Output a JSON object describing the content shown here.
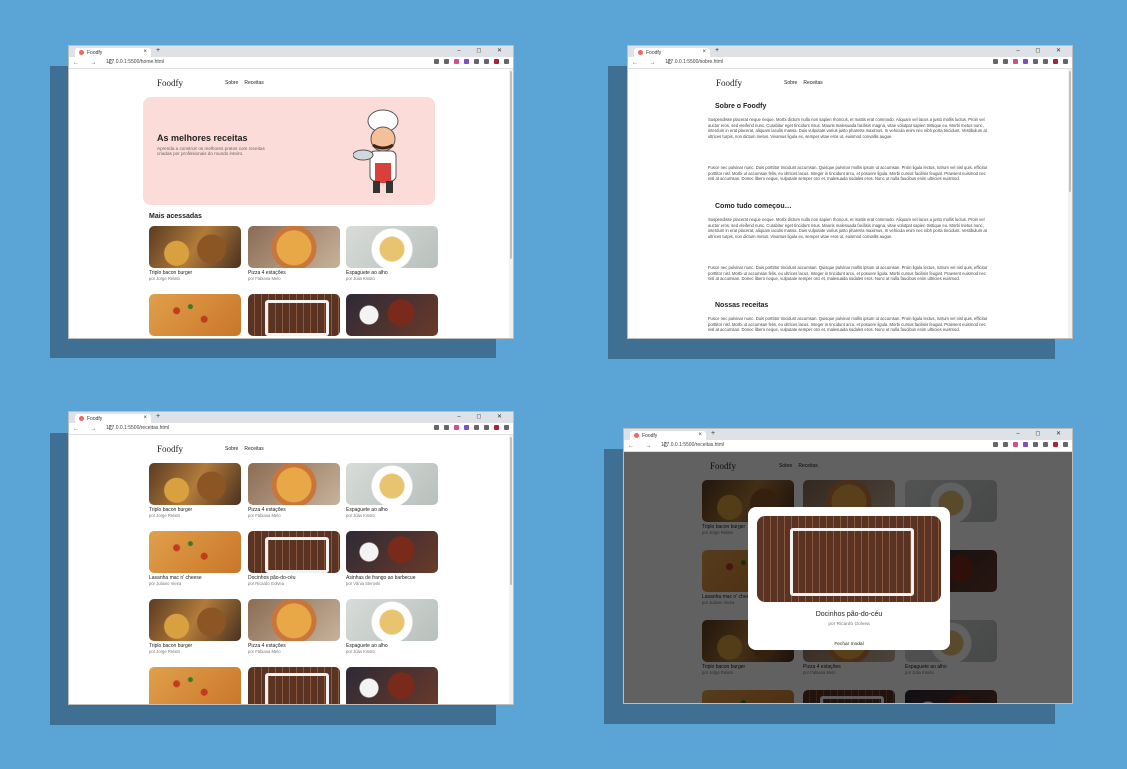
{
  "browser": {
    "tab_title": "Foodfy",
    "new_tab": "+",
    "close_tab": "×",
    "nav_icons": "← → C",
    "win_controls": "– ◻ ✕",
    "urls": {
      "home": "127.0.0.1:5500/home.html",
      "sobre": "127.0.0.1:5500/sobre.html",
      "receitas": "127.0.0.1:5500/receitas.html"
    }
  },
  "site": {
    "logo": "Foodfy",
    "menu": [
      "Sobre",
      "Receitas"
    ]
  },
  "home": {
    "hero_title": "As melhores receitas",
    "hero_text": "Aprenda a construir os melhores pratos com receitas criadas por profissionais do mundo inteiro.",
    "section_title": "Mais acessadas"
  },
  "recipes": [
    {
      "title": "Triplo bacon burger",
      "author": "por Jorge Relato",
      "image": "burger"
    },
    {
      "title": "Pizza 4 estações",
      "author": "por Fabiana Melo",
      "image": "pizza"
    },
    {
      "title": "Espaguete ao alho",
      "author": "por Júlia Kinoto",
      "image": "spag"
    },
    {
      "title": "Lasanha mac n' cheese",
      "author": "por Juliano Vieira",
      "image": "lasagna"
    },
    {
      "title": "Docinhos pão-do-céu",
      "author": "por Ricardo Golvea",
      "image": "doces"
    },
    {
      "title": "Asinhas de frango ao barbecue",
      "author": "por Vânia Steroski",
      "image": "asinhas"
    }
  ],
  "sobre": {
    "h1": "Sobre o Foodfy",
    "h2": "Como tudo começou…",
    "h3": "Nossas receitas",
    "p1": "Suspendisse placerat neque neque. Morbi dictum nulla non sapien rhoncus, et mattis erat commodo. Aliquam vel lacus a justo mollis luctus. Proin vel auctor eros, sed eleifend nunc. Curabitur eget tincidunt risus. Mauris malesuada facilisis magna, vitae volutpat sapien tristique eu. Morbi metus nunc, interdum in erat placerat, aliquam iaculis massa. Duis vulputate varius justo pharetra maximus. In vehicula enim nec nibh porta tincidunt. Vestibulum at ultrices turpis, non dictum metus. Vivamus ligula ex, semper vitae eros ut, euismod convallis augue.",
    "p2": "Fusce nec pulvinar nunc. Duis porttitor tincidunt accumsan. Quisque pulvinar mollis ipsum ut accumsan. Proin ligula lectus, rutrum vel nisl quis, efficitur porttitor nisl. Morbi ut accumsan felis, eu ultrices lacus. Integer in tincidunt arcu, et posuere ligula. Morbi cursus facilisis feugiat. Praesent euismod nec nisl at accumsan. Donec libero neque, vulputate semper orci et, malesuada sodales eros. Nunc ut nulla faucibus enim ultricies euismod."
  },
  "modal": {
    "title": "Docinhos pão-do-céu",
    "author": "por Ricardo Golvea",
    "close": "Fechar modal"
  }
}
